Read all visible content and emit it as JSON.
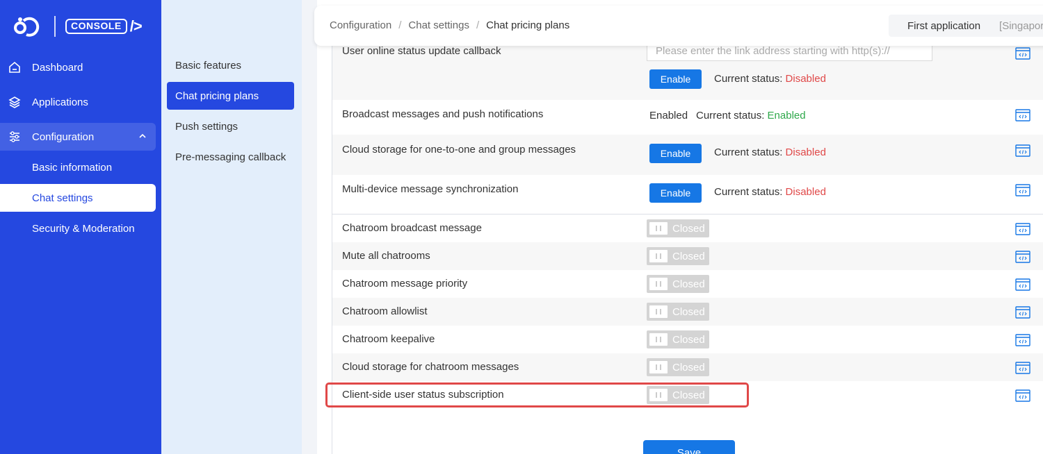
{
  "brand": {
    "console_label": "CONSOLE",
    "console_suffix": "/>"
  },
  "sidebar": {
    "items": [
      {
        "label": "Dashboard",
        "icon": "home-icon"
      },
      {
        "label": "Applications",
        "icon": "layers-icon"
      },
      {
        "label": "Configuration",
        "icon": "sliders-icon",
        "expanded": true
      }
    ],
    "sub_items": [
      {
        "label": "Basic information"
      },
      {
        "label": "Chat settings",
        "active": true
      },
      {
        "label": "Security & Moderation"
      }
    ]
  },
  "submenu": {
    "items": [
      {
        "label": "Basic features"
      },
      {
        "label": "Chat pricing plans",
        "active": true
      },
      {
        "label": "Push settings"
      },
      {
        "label": "Pre-messaging callback"
      }
    ]
  },
  "header": {
    "breadcrumb": [
      "Configuration",
      "Chat settings",
      "Chat pricing plans"
    ],
    "app_name": "First application",
    "app_region": "[Singapore]"
  },
  "features": {
    "online_callback": {
      "label": "User online status update callback",
      "placeholder": "Please enter the link address starting with http(s)://",
      "button": "Enable",
      "status_prefix": "Current status:",
      "status": "Disabled"
    },
    "broadcast": {
      "label": "Broadcast messages and push notifications",
      "state": "Enabled",
      "status_prefix": "Current status:",
      "status": "Enabled"
    },
    "cloud_storage": {
      "label": "Cloud storage for one-to-one and group messages",
      "button": "Enable",
      "status_prefix": "Current status:",
      "status": "Disabled"
    },
    "multi_device": {
      "label": "Multi-device message synchronization",
      "button": "Enable",
      "status_prefix": "Current status:",
      "status": "Disabled"
    }
  },
  "toggles": [
    {
      "label": "Chatroom broadcast message",
      "state": "Closed"
    },
    {
      "label": "Mute all chatrooms",
      "state": "Closed"
    },
    {
      "label": "Chatroom message priority",
      "state": "Closed"
    },
    {
      "label": "Chatroom allowlist",
      "state": "Closed"
    },
    {
      "label": "Chatroom keepalive",
      "state": "Closed"
    },
    {
      "label": "Cloud storage for chatroom messages",
      "state": "Closed"
    },
    {
      "label": "Client-side user status subscription",
      "state": "Closed",
      "highlighted": true
    }
  ],
  "save_label": "Save",
  "colors": {
    "sidebar": "#2548e0",
    "primary_button": "#1677e5",
    "disabled": "#e04848",
    "enabled": "#2ea84a",
    "highlight": "#e04848"
  }
}
